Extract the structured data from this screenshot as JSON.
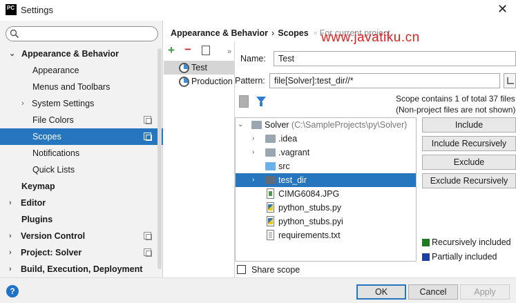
{
  "window": {
    "title": "Settings",
    "app_icon_text": "PC",
    "close_glyph": "✕"
  },
  "search": {
    "placeholder": ""
  },
  "sidebar": {
    "items": [
      {
        "label": "Appearance & Behavior",
        "arrow": "⌄"
      },
      {
        "label": "Appearance"
      },
      {
        "label": "Menus and Toolbars"
      },
      {
        "label": "System Settings",
        "arrow": "›"
      },
      {
        "label": "File Colors"
      },
      {
        "label": "Scopes"
      },
      {
        "label": "Notifications"
      },
      {
        "label": "Quick Lists"
      },
      {
        "label": "Keymap"
      },
      {
        "label": "Editor",
        "arrow": "›"
      },
      {
        "label": "Plugins"
      },
      {
        "label": "Version Control",
        "arrow": "›"
      },
      {
        "label": "Project: Solver",
        "arrow": "›"
      },
      {
        "label": "Build, Execution, Deployment",
        "arrow": "›"
      }
    ]
  },
  "breadcrumb": {
    "parent": "Appearance & Behavior",
    "separator": "›",
    "current": "Scopes",
    "project_note": "For current project"
  },
  "watermark": "www.javatiku.cn",
  "scope_list": {
    "add_glyph": "+",
    "remove_glyph": "−",
    "more_glyph": "»",
    "items": [
      {
        "label": "Test"
      },
      {
        "label": "Production"
      }
    ]
  },
  "form": {
    "name_label": "Name:",
    "name_value": "Test",
    "pattern_label": "Pattern:",
    "pattern_value": "file[Solver]:test_dir//*"
  },
  "scope_info": {
    "line1": "Scope contains 1 of total 37 files",
    "line2": "(Non-project files are not shown)"
  },
  "tree": {
    "rows": [
      {
        "label": "Solver",
        "path": "(C:\\SampleProjects\\py\\Solver)",
        "arrow": "⌄"
      },
      {
        "label": ".idea",
        "arrow": "›"
      },
      {
        "label": ".vagrant",
        "arrow": "›"
      },
      {
        "label": "src"
      },
      {
        "label": "test_dir",
        "arrow": "›"
      },
      {
        "label": "CIMG6084.JPG"
      },
      {
        "label": "python_stubs.py"
      },
      {
        "label": "python_stubs.pyi"
      },
      {
        "label": "requirements.txt"
      }
    ]
  },
  "actions": {
    "include": "Include",
    "include_recursively": "Include Recursively",
    "exclude": "Exclude",
    "exclude_recursively": "Exclude Recursively"
  },
  "legend": {
    "recursive_label": "Recursively included",
    "recursive_color": "#1e7a1e",
    "partial_label": "Partially included",
    "partial_color": "#1f3fa0"
  },
  "share_scope": {
    "label": "Share scope",
    "checked": false
  },
  "footer": {
    "help_glyph": "?",
    "ok": "OK",
    "cancel": "Cancel",
    "apply": "Apply"
  },
  "colors": {
    "selection": "#2675bf",
    "sidebar_bg": "#f2f2f2",
    "watermark": "#e02020"
  }
}
